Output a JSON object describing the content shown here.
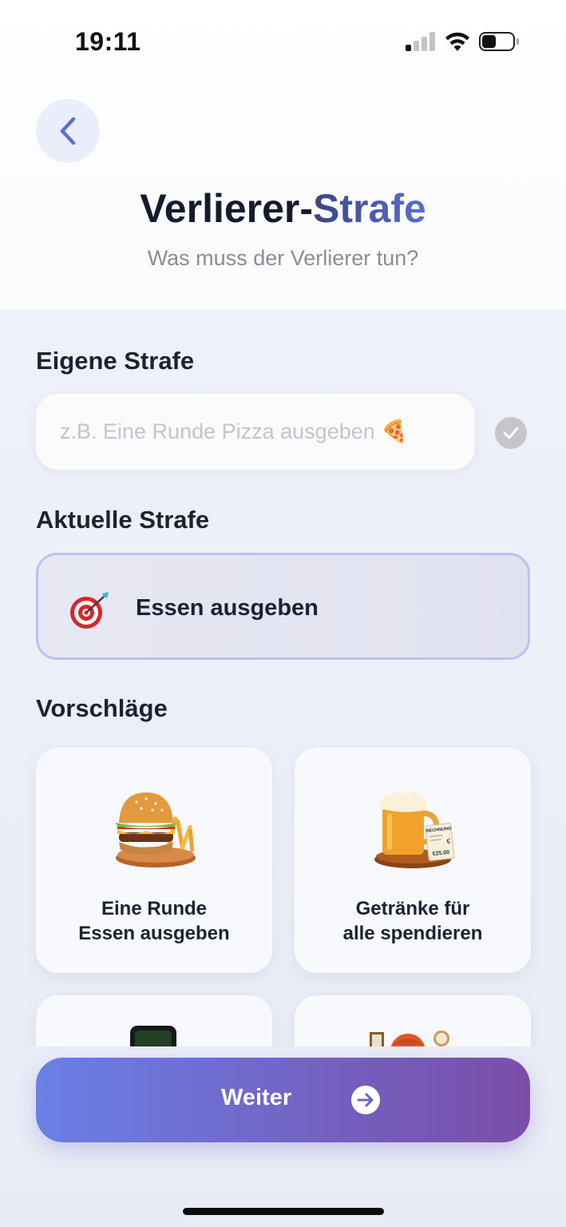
{
  "status_bar": {
    "time": "19:11"
  },
  "header": {
    "title_part1": "Verlierer-",
    "title_part2": "Strafe",
    "subtitle": "Was muss der Verlierer tun?"
  },
  "custom_penalty": {
    "section_label": "Eigene Strafe",
    "placeholder": "z.B. Eine Runde Pizza ausgeben 🍕",
    "value": ""
  },
  "current_penalty": {
    "section_label": "Aktuelle Strafe",
    "icon": "target-dart-icon",
    "label": "Essen ausgeben"
  },
  "suggestions": {
    "section_label": "Vorschläge",
    "items": [
      {
        "icon": "burger-fries-icon",
        "line1": "Eine Runde",
        "line2": "Essen ausgeben"
      },
      {
        "icon": "beer-receipt-icon",
        "line1": "Getränke für",
        "line2": "alle spendieren",
        "receipt_title": "RECHNUNG",
        "receipt_amount": "€25.00"
      },
      {
        "icon": "phone-icon"
      },
      {
        "icon": "mascot-icon"
      }
    ]
  },
  "footer": {
    "button_label": "Weiter"
  },
  "colors": {
    "accent": "#5a6fd0",
    "button_start": "#6a80e6",
    "button_end": "#7a4ea8"
  }
}
